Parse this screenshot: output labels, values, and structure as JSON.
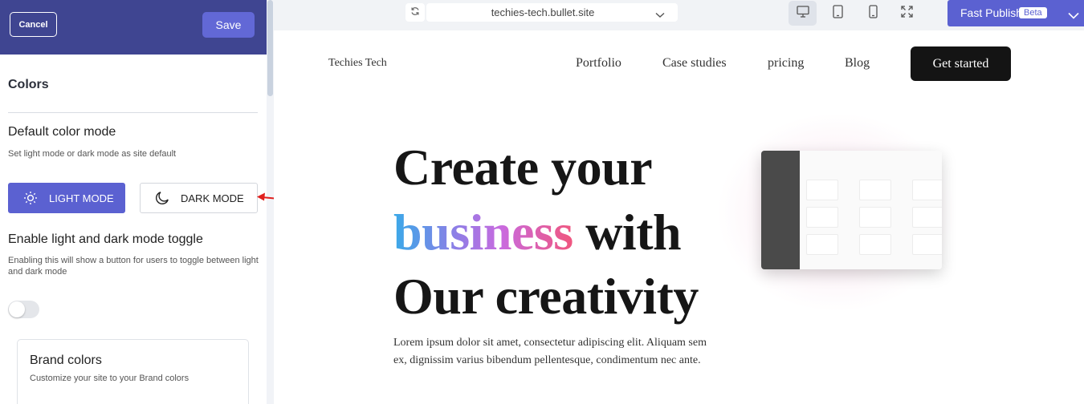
{
  "panel": {
    "cancel_label": "Cancel",
    "save_label": "Save",
    "section_title": "Colors",
    "default_mode_title": "Default color mode",
    "default_mode_desc": "Set light mode or dark mode as site default",
    "light_mode_label": "LIGHT MODE",
    "dark_mode_label": "DARK MODE",
    "selected_mode": "light",
    "toggle_title": "Enable light and dark mode toggle",
    "toggle_desc_line1": "Enabling this will show a button for users to toggle between light",
    "toggle_desc_line2": "and dark mode",
    "toggle_on": false,
    "brand_title": "Brand colors",
    "brand_desc": "Customize your site to your Brand colors"
  },
  "toolbar": {
    "url": "techies-tech.bullet.site",
    "active_device": "desktop",
    "publish_label": "Fast Publish",
    "beta_label": "Beta"
  },
  "site": {
    "logo": "Techies Tech",
    "nav": [
      "Portfolio",
      "Case studies",
      "pricing",
      "Blog"
    ],
    "cta": "Get started",
    "hero_line1": "Create your",
    "hero_gradient_word": "business",
    "hero_line2_rest": " with",
    "hero_line3": "Our creativity",
    "hero_paragraph": "Lorem ipsum dolor sit amet, consectetur adipiscing elit. Aliquam sem ex, dignissim  varius bibendum pellentesque, condimentum nec ante."
  },
  "colors": {
    "panel_header": "#3f4591",
    "accent": "#5b61d1",
    "arrow": "#e0201e",
    "cta_bg": "#141414"
  }
}
